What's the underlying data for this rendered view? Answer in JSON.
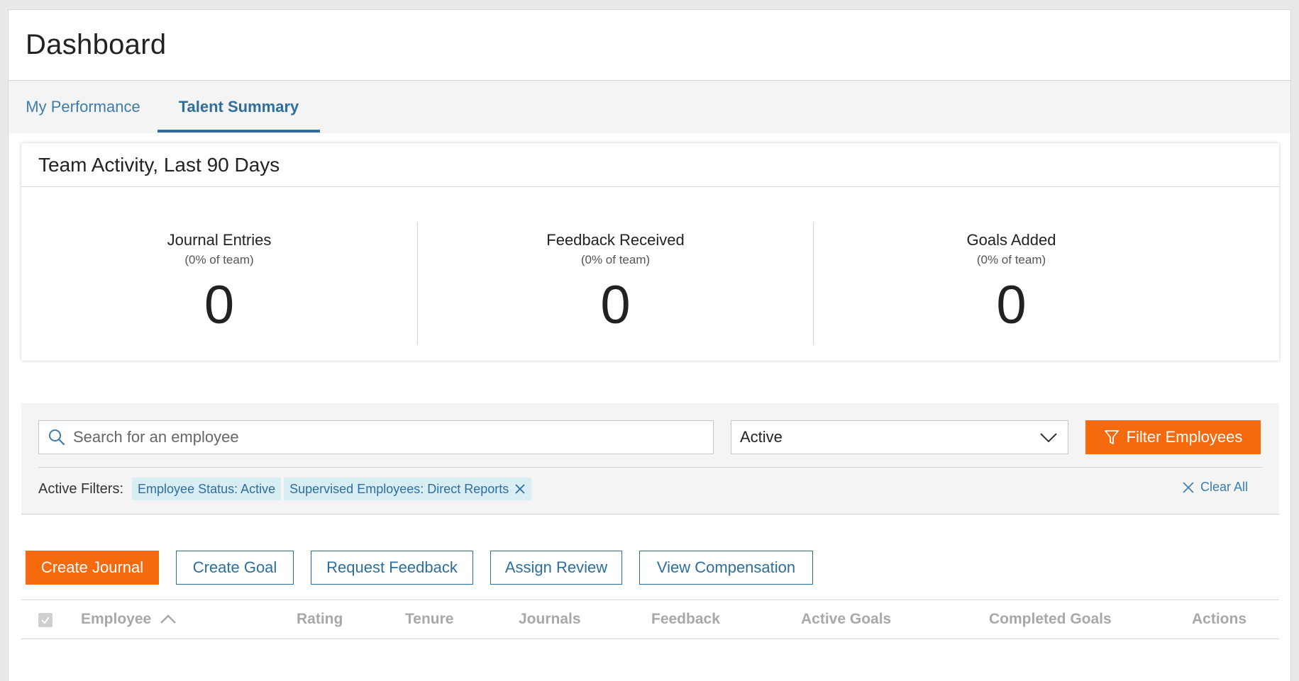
{
  "header": {
    "title": "Dashboard"
  },
  "tabs": [
    {
      "label": "My Performance",
      "active": false
    },
    {
      "label": "Talent Summary",
      "active": true
    }
  ],
  "team_activity": {
    "title": "Team Activity, Last 90 Days",
    "stats": [
      {
        "label": "Journal Entries",
        "sub": "(0% of team)",
        "value": "0"
      },
      {
        "label": "Feedback Received",
        "sub": "(0% of team)",
        "value": "0"
      },
      {
        "label": "Goals Added",
        "sub": "(0% of team)",
        "value": "0"
      }
    ]
  },
  "filters": {
    "search_placeholder": "Search for an employee",
    "status_select": "Active",
    "filter_button": "Filter Employees",
    "active_filters_label": "Active Filters:",
    "chips": [
      "Employee Status: Active",
      "Supervised Employees: Direct Reports"
    ],
    "clear_all": "Clear All"
  },
  "actions": {
    "create_journal": "Create Journal",
    "create_goal": "Create Goal",
    "request_feedback": "Request Feedback",
    "assign_review": "Assign Review",
    "view_compensation": "View Compensation"
  },
  "table": {
    "columns": [
      "Employee",
      "Rating",
      "Tenure",
      "Journals",
      "Feedback",
      "Active Goals",
      "Completed Goals",
      "Actions"
    ],
    "sort_column": "Employee",
    "sort_direction": "ascending"
  },
  "colors": {
    "accent_orange": "#f56a0e",
    "link_blue": "#2d6e9f",
    "chip_bg": "#d8edf4",
    "muted_header": "#a8a8a8"
  },
  "icons": {
    "search": "search-icon",
    "dropdown": "chevron-down-icon",
    "filter": "filter-icon",
    "remove": "close-icon",
    "sort": "sort-ascending-icon",
    "checkbox": "checkbox-icon"
  }
}
